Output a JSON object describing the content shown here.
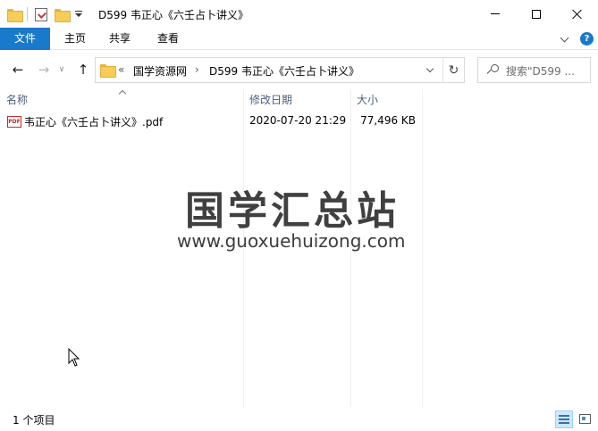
{
  "window": {
    "title": "D599 韦正心《六壬占卜讲义》",
    "minimize_icon": "minimize-icon",
    "maximize_icon": "maximize-icon",
    "close_icon": "close-icon"
  },
  "ribbon": {
    "tabs": [
      {
        "label": "文件",
        "active": true
      },
      {
        "label": "主页"
      },
      {
        "label": "共享"
      },
      {
        "label": "查看"
      }
    ],
    "help_label": "?"
  },
  "navigation": {
    "back_glyph": "←",
    "forward_glyph": "→",
    "recent_glyph": "∨",
    "up_glyph": "↑",
    "breadcrumb": {
      "more": "«",
      "items": [
        "国学资源网",
        "D599 韦正心《六壬占卜讲义》"
      ],
      "separator": "›"
    },
    "refresh_glyph": "↻",
    "search_placeholder": "搜索\"D599 ..."
  },
  "file_list": {
    "columns": [
      {
        "label": "名称"
      },
      {
        "label": "修改日期"
      },
      {
        "label": "大小"
      }
    ],
    "rows": [
      {
        "icon": "pdf-icon",
        "icon_label": "PDF",
        "name": "韦正心《六壬占卜讲义》.pdf",
        "modified": "2020-07-20 21:29",
        "size": "77,496 KB"
      }
    ]
  },
  "watermark": {
    "logo_text": "国学汇总站",
    "url": "www.guoxuehuizong.com"
  },
  "status": {
    "item_count": "1 个项目"
  },
  "colors": {
    "accent": "#1979ca",
    "column_header": "#4c607a",
    "selected_view": "#cce8ff"
  }
}
